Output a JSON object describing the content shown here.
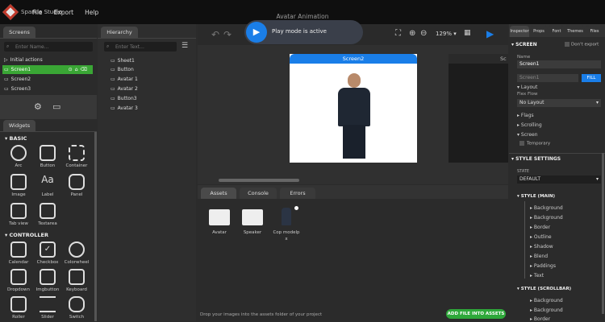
{
  "app": {
    "name": "Sparkle Studio",
    "window_title": "Avatar Animation"
  },
  "menu": [
    "File",
    "Export",
    "Help"
  ],
  "screens_panel": {
    "tab": "Screens",
    "search_placeholder": "Enter Name...",
    "items": [
      {
        "label": "Initial actions",
        "selected": false
      },
      {
        "label": "Screen1",
        "selected": true
      },
      {
        "label": "Screen2",
        "selected": false
      },
      {
        "label": "Screen3",
        "selected": false
      }
    ]
  },
  "hierarchy_panel": {
    "tab": "Hierarchy",
    "search_placeholder": "Enter Text...",
    "items": [
      "Sheet1",
      "Button",
      "Avatar 1",
      "Avatar 2",
      "Button3",
      "Avatar 3"
    ]
  },
  "widgets_panel": {
    "tab": "Widgets",
    "basic_label": "BASIC",
    "basic": [
      "Arc",
      "Button",
      "Container",
      "Image",
      "Label",
      "Panel",
      "Tab view",
      "Textarea"
    ],
    "controller_label": "CONTROLLER",
    "controller": [
      "Calendar",
      "Checkbox",
      "Colorwheel",
      "Dropdown",
      "Imgbutton",
      "Keyboard",
      "Roller",
      "Slider",
      "Switch"
    ]
  },
  "toolbar": {
    "play_message": "Play mode is active",
    "zoom": "129%"
  },
  "canvas": {
    "screen_title": "Screen2",
    "second_screen_title": "Sc"
  },
  "bottom_panel": {
    "tabs": [
      "Assets",
      "Console",
      "Errors"
    ],
    "assets": [
      {
        "label": "Avatar",
        "type": "folder"
      },
      {
        "label": "Speaker",
        "type": "folder"
      },
      {
        "label": "Cop modelp\nx",
        "type": "image"
      }
    ],
    "footer_text": "Drop your images into the assets folder of your project",
    "add_button": "ADD FILE INTO ASSETS"
  },
  "inspector": {
    "tabs": [
      "Inspector",
      "Props",
      "Font",
      "Themes",
      "Files"
    ],
    "screen_section": "SCREEN",
    "dont_export": "Don't export",
    "name_label": "Name",
    "name_value": "Screen1",
    "screen_input": "Screen1",
    "fill_button": "FILL",
    "layout_label": "Layout",
    "flex_flow_label": "Flex Flow",
    "flex_flow_value": "No Layout",
    "flags_label": "Flags",
    "scrolling_label": "Scrolling",
    "screen_sub_label": "Screen",
    "temporary_label": "Temporary",
    "style_settings": "STYLE SETTINGS",
    "state_label": "STATE",
    "state_value": "DEFAULT",
    "style_main": "STYLE (MAIN)",
    "main_props": [
      "Background",
      "Background",
      "Border",
      "Outline",
      "Shadow",
      "Blend",
      "Paddings",
      "Text"
    ],
    "style_scrollbar": "STYLE (SCROLLBAR)",
    "scrollbar_props": [
      "Background",
      "Background",
      "Border"
    ]
  },
  "colors": {
    "accent": "#1a7ee8",
    "selected": "#3aa635",
    "green_button": "#2ea83a"
  }
}
